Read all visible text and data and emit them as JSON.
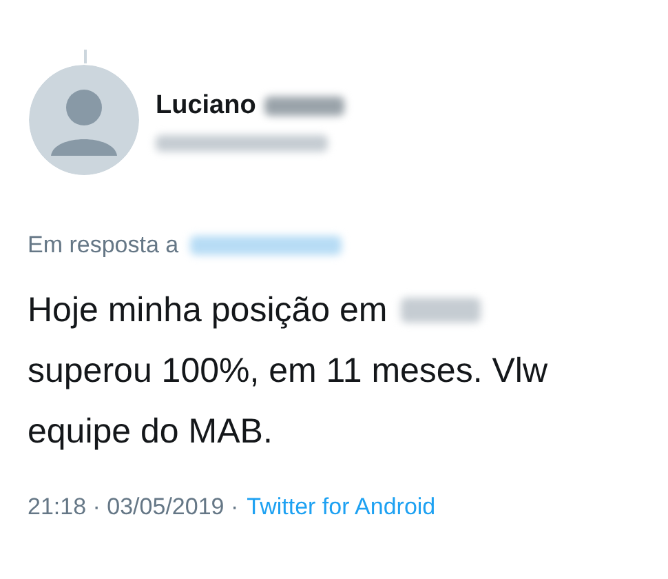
{
  "author": {
    "name": "Luciano"
  },
  "reply_to": {
    "label": "Em resposta a"
  },
  "body": {
    "first_line": "Hoje minha posição em",
    "rest": "superou 100%, em 11 meses. Vlw equipe do MAB."
  },
  "footer": {
    "timestamp": "21:18 · 03/05/2019 ·",
    "source": "Twitter for Android"
  }
}
